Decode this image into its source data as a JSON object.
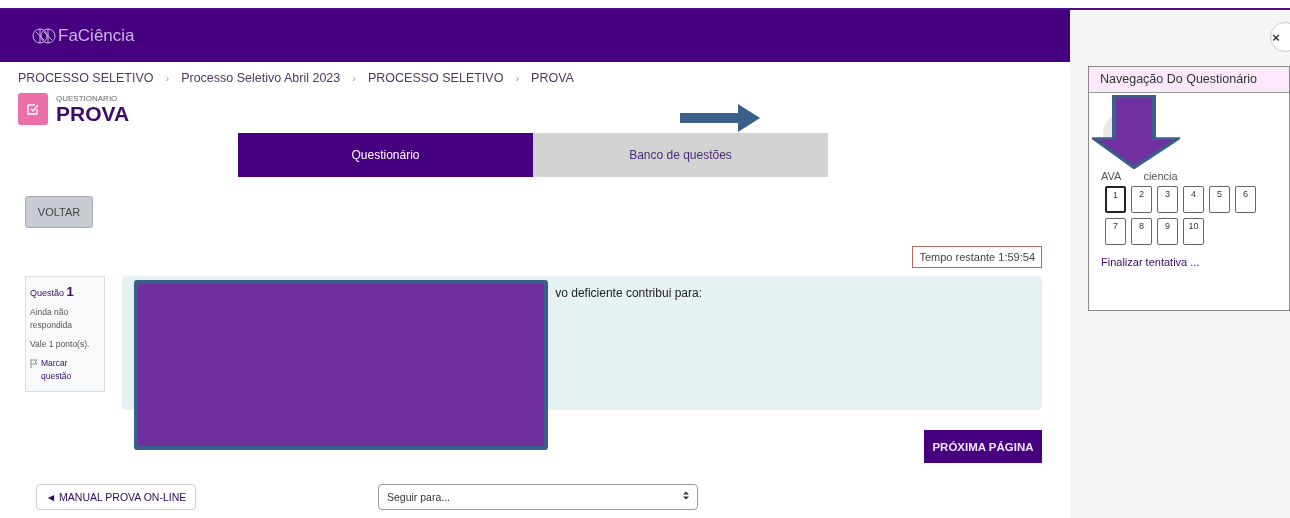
{
  "header": {
    "logo_text": "FaCiência"
  },
  "breadcrumb": [
    "PROCESSO SELETIVO",
    "Processo Seletivo Abril 2023",
    "PROCESSO SELETIVO",
    "PROVA"
  ],
  "breadcrumb_separators": [
    "›",
    "›",
    "›"
  ],
  "page": {
    "kicker": "QUESTIONARIO",
    "title": "PROVA"
  },
  "tabs": [
    {
      "label": "Questionário",
      "selected": true
    },
    {
      "label": "Banco de questões",
      "selected": false
    }
  ],
  "back_button": "VOLTAR",
  "timer": "Tempo restante 1:59:54",
  "question_info": {
    "label": "Questão",
    "number": "1",
    "status": "Ainda não respondida",
    "points": "Vale 1 ponto(s).",
    "flag": "Marcar questão"
  },
  "question_text": "vo deficiente contribui para:",
  "next_button": "PRÓXIMA PÁGINA",
  "manual_button": "◄ MANUAL PROVA ON-LINE",
  "jump_select": {
    "value": "Seguir para..."
  },
  "nav": {
    "title": "Navegação Do Questionário",
    "user_parts": [
      "AVA",
      "ciencia"
    ],
    "questions": [
      {
        "label": "1",
        "selected": true
      },
      {
        "label": "2",
        "selected": false
      },
      {
        "label": "3",
        "selected": false
      },
      {
        "label": "4",
        "selected": false
      },
      {
        "label": "5",
        "selected": false
      },
      {
        "label": "6",
        "selected": false
      },
      {
        "label": "7",
        "selected": false
      },
      {
        "label": "8",
        "selected": false
      },
      {
        "label": "9",
        "selected": false
      },
      {
        "label": "10",
        "selected": false
      }
    ],
    "finish": "Finalizar tentativa ..."
  },
  "close_button": "×"
}
